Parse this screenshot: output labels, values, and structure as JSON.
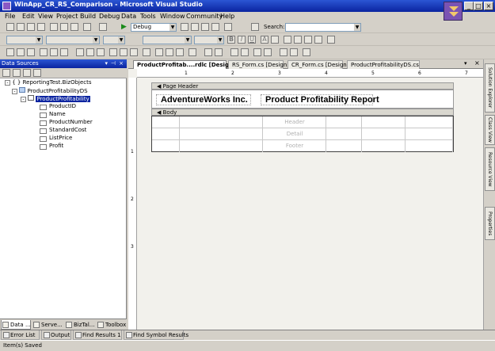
{
  "window": {
    "title": "WinApp_CR_RS_Comparison - Microsoft Visual Studio"
  },
  "menu": [
    "File",
    "Edit",
    "View",
    "Project",
    "Build",
    "Debug",
    "Data",
    "Tools",
    "Window",
    "Community",
    "Help"
  ],
  "toolbar": {
    "config": "Debug",
    "search_label": "Search:",
    "search_value": ""
  },
  "data_sources": {
    "title": "Data Sources",
    "tree": {
      "root": "ReportingTest.BizObjects",
      "dataset": "ProductProfitabilityDS",
      "table": "ProductProfitability",
      "fields": [
        "ProductID",
        "Name",
        "ProductNumber",
        "StandardCost",
        "ListPrice",
        "Profit"
      ]
    },
    "bottom_tabs": [
      "Data ...",
      "Serve...",
      "BizTal...",
      "Toolbox"
    ]
  },
  "doc_tabs": [
    "ProductProfitab....rdlc [Design]*",
    "RS_Form.cs [Design]",
    "CR_Form.cs [Design]",
    "ProductProfitabilityDS.cs"
  ],
  "report": {
    "page_header_label": "Page Header",
    "body_label": "Body",
    "company": "AdventureWorks Inc.",
    "report_title": "Product Profitability Report",
    "table_rows": [
      "Header",
      "Detail",
      "Footer"
    ],
    "ruler_h": [
      "1",
      "2",
      "3",
      "4",
      "5",
      "6",
      "7"
    ],
    "ruler_v": [
      "1",
      "2",
      "3"
    ]
  },
  "right_panel": [
    "Solution Explorer",
    "Class View",
    "Resource View",
    "Properties"
  ],
  "output_tabs": [
    "Error List",
    "Output",
    "Find Results 1",
    "Find Symbol Results"
  ],
  "status": "Item(s) Saved"
}
